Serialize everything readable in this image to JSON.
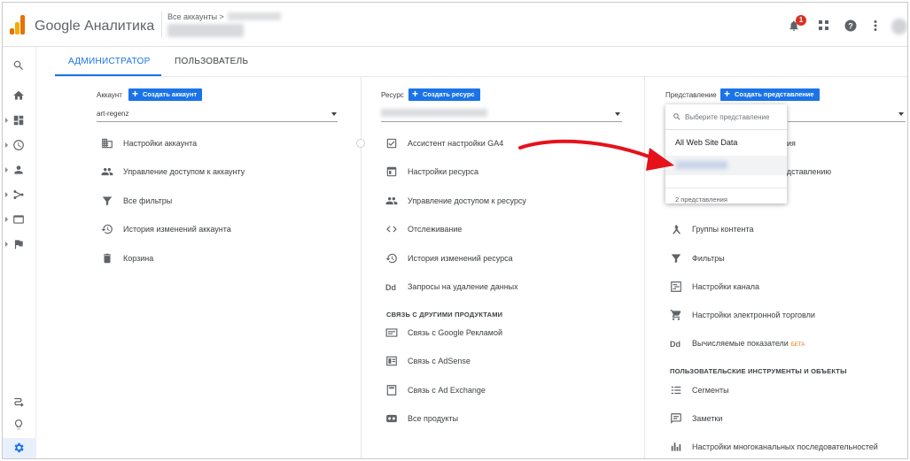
{
  "header": {
    "brand": "Google Аналитика",
    "account_path": "Все аккаунты >",
    "notification_count": "1"
  },
  "tabs": [
    {
      "label": "АДМИНИСТРАТОР"
    },
    {
      "label": "ПОЛЬЗОВАТЕЛЬ"
    }
  ],
  "account": {
    "title": "Аккаунт",
    "create_label": "Создать аккаунт",
    "selected": "art-regenz",
    "items": [
      {
        "label": "Настройки аккаунта",
        "icon": "building-icon"
      },
      {
        "label": "Управление доступом к аккаунту",
        "icon": "people-icon"
      },
      {
        "label": "Все фильтры",
        "icon": "filter-icon"
      },
      {
        "label": "История изменений аккаунта",
        "icon": "history-icon"
      },
      {
        "label": "Корзина",
        "icon": "trash-icon"
      }
    ]
  },
  "property": {
    "title": "Ресурс",
    "create_label": "Создать ресурс",
    "items": [
      {
        "label": "Ассистент настройки GA4",
        "icon": "checkbox-icon"
      },
      {
        "label": "Настройки ресурса",
        "icon": "window-icon"
      },
      {
        "label": "Управление доступом к ресурсу",
        "icon": "people-icon"
      },
      {
        "label": "Отслеживание",
        "icon": "code-icon"
      },
      {
        "label": "История изменений ресурса",
        "icon": "history-icon"
      },
      {
        "label": "Запросы на удаление данных",
        "icon": "dd-icon"
      }
    ],
    "section_title": "СВЯЗЬ С ДРУГИМИ ПРОДУКТАМИ",
    "links": [
      {
        "label": "Связь с Google Рекламой",
        "icon": "ads-icon"
      },
      {
        "label": "Связь с AdSense",
        "icon": "adsense-icon"
      },
      {
        "label": "Связь с Ad Exchange",
        "icon": "adexchange-icon"
      },
      {
        "label": "Все продукты",
        "icon": "products-icon"
      }
    ]
  },
  "view": {
    "title": "Представление",
    "create_label": "Создать представление",
    "items_tail": [
      {
        "label": "ения"
      },
      {
        "label": "редставлению"
      }
    ],
    "items": [
      {
        "label": "Группы контента",
        "icon": "content-groups-icon"
      },
      {
        "label": "Фильтры",
        "icon": "filter-icon"
      },
      {
        "label": "Настройки канала",
        "icon": "channel-icon"
      },
      {
        "label": "Настройки электронной торговли",
        "icon": "cart-icon"
      },
      {
        "label": "Вычисляемые показатели",
        "icon": "dd-icon",
        "badge": "БЕТА"
      }
    ],
    "section_title": "ПОЛЬЗОВАТЕЛЬСКИЕ ИНСТРУМЕНТЫ И ОБЪЕКТЫ",
    "tools": [
      {
        "label": "Сегменты",
        "icon": "segments-icon"
      },
      {
        "label": "Заметки",
        "icon": "notes-icon"
      },
      {
        "label": "Настройки многоканальных последовательностей",
        "icon": "multichannel-icon"
      }
    ]
  },
  "dropdown": {
    "placeholder": "Выберите представление",
    "option": "All Web Site Data",
    "count": "2 представления"
  },
  "colors": {
    "accent": "#1a73e8",
    "arrow": "#e5121b",
    "badge": "#d93025",
    "beta": "#e37400"
  }
}
